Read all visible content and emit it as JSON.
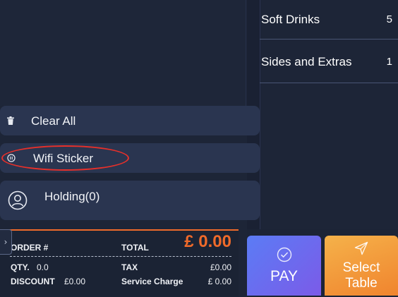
{
  "categories": [
    {
      "name": "Soft Drinks",
      "count": "5"
    },
    {
      "name": "Sides and Extras",
      "count": "1"
    }
  ],
  "actions": {
    "clear_all": "Clear All",
    "wifi_sticker": "Wifi Sticker",
    "holding": "Holding(0)"
  },
  "summary": {
    "order_label": "ORDER #",
    "total_label": "TOTAL",
    "total_value": "£ 0.00",
    "qty_label": "QTY.",
    "qty_value": "0.0",
    "tax_label": "TAX",
    "tax_value": "£0.00",
    "discount_label": "DISCOUNT",
    "discount_value": "£0.00",
    "service_label": "Service Charge",
    "service_value": "£ 0.00"
  },
  "buttons": {
    "pay": "PAY",
    "select_table": "Select Table"
  },
  "colors": {
    "accent_orange": "#f06a2a",
    "annotation_red": "#e8302a",
    "pay_gradient_start": "#5b7cf5",
    "select_gradient_start": "#f5b24a"
  },
  "icons": {
    "clear_all": "trash-icon",
    "wifi": "pause-circle-icon",
    "holding": "user-icon",
    "pay": "check-circle-icon",
    "select_table": "send-icon",
    "collapse": "chevron-right-icon"
  }
}
